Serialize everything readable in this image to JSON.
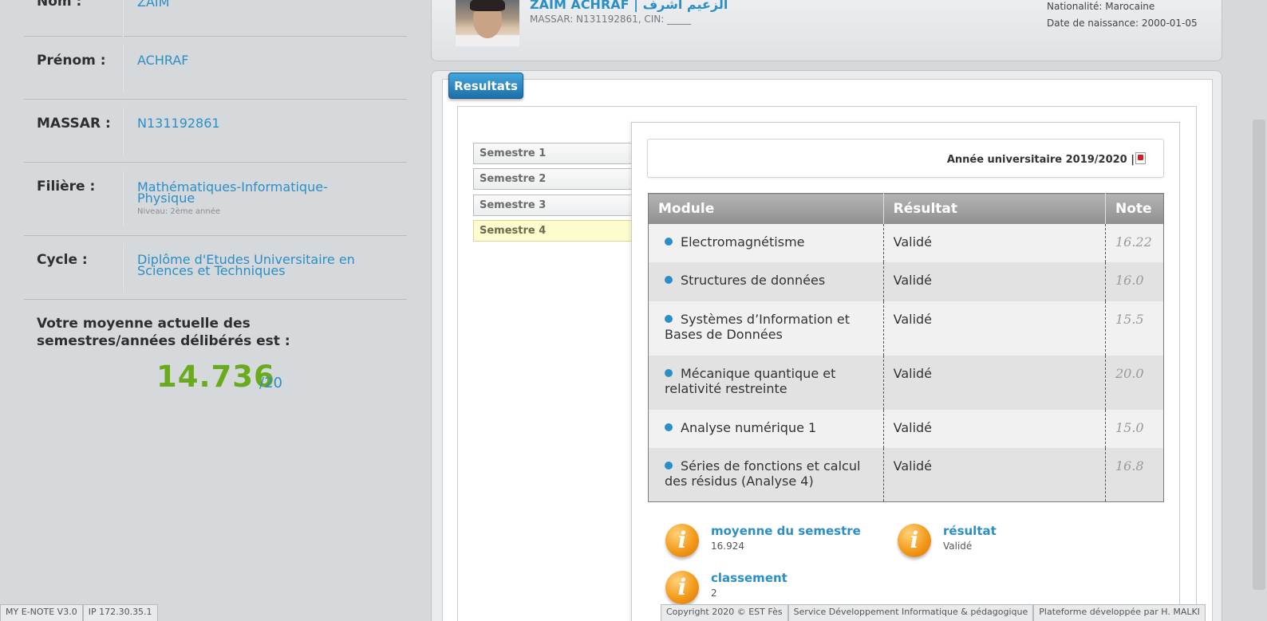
{
  "profile": {
    "nom_label": "Nom :",
    "nom_value": "ZAIM",
    "prenom_label": "Prénom :",
    "prenom_value": "ACHRAF",
    "massar_label": "MASSAR :",
    "massar_value": "N131192861",
    "filiere_label": "Filière :",
    "filiere_value": "Mathématiques-Informatique-Physique",
    "niveau": "Niveau: 2ème année",
    "cycle_label": "Cycle :",
    "cycle_value": "Diplôme d'Etudes Universitaire en Sciences et Techniques",
    "moyenne_label": "Votre moyenne actuelle des semestres/années délibérés est :",
    "moyenne_value": "14.736",
    "moyenne_max": "/20"
  },
  "student": {
    "name": "ZAIM ACHRAF | الزعيم اشرف",
    "massar_line": "MASSAR: N131192861, CIN: _____",
    "nationality": "Nationalité: Marocaine",
    "birth": "Date de naissance: 2000-01-05"
  },
  "results": {
    "tab_label": "Resultats",
    "semesters": [
      "Semestre 1",
      "Semestre 2",
      "Semestre 3",
      "Semestre 4"
    ],
    "active_semester": "Semestre 4",
    "year_label": "Année universitaire 2019/2020 |",
    "columns": [
      "Module",
      "Résultat",
      "Note"
    ],
    "modules": [
      {
        "name": "Electromagnétisme",
        "result": "Validé",
        "note": "16.22"
      },
      {
        "name": "Structures de données",
        "result": "Validé",
        "note": "16.0"
      },
      {
        "name": "Systèmes d’Information et Bases de Données",
        "result": "Validé",
        "note": "15.5"
      },
      {
        "name": "Mécanique quantique et relativité restreinte",
        "result": "Validé",
        "note": "20.0"
      },
      {
        "name": "Analyse numérique 1",
        "result": "Validé",
        "note": "15.0"
      },
      {
        "name": "Séries de fonctions et calcul des résidus (Analyse 4)",
        "result": "Validé",
        "note": "16.8"
      }
    ],
    "summary": {
      "moyenne_title": "moyenne du semestre",
      "moyenne_value": "16.924",
      "resultat_title": "résultat",
      "resultat_value": "Validé",
      "classement_title": "classement",
      "classement_value": "2"
    }
  },
  "footer": {
    "version": "MY E-NOTE V3.0",
    "ip": "IP 172.30.35.1",
    "copyright": "Copyright 2020 © EST Fès",
    "service": "Service Développement Informatique & pédagogique",
    "platform": "Plateforme développée par H. MALKI"
  },
  "colors": {
    "accent": "#2b8fc5",
    "average_green": "#6aab1e",
    "info_orange": "#f39a1a"
  }
}
